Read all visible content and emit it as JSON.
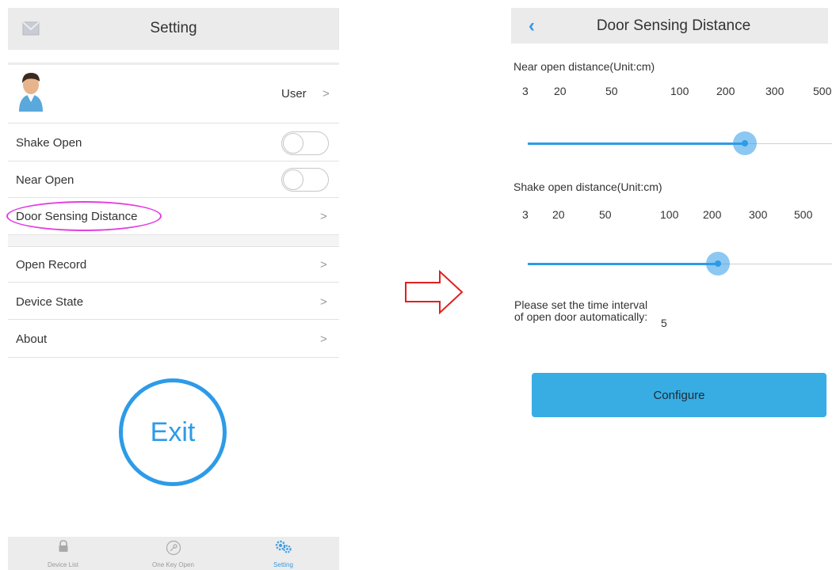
{
  "setting": {
    "title": "Setting",
    "user_label": "User",
    "rows": {
      "shake_open": "Shake Open",
      "near_open": "Near Open",
      "door_sensing": "Door Sensing Distance",
      "open_record": "Open Record",
      "device_state": "Device State",
      "about": "About"
    },
    "chevron": ">",
    "toggles": {
      "shake_open": false,
      "near_open": false
    },
    "exit_label": "Exit",
    "tabs": [
      {
        "label": "Device List",
        "icon": "lock-icon"
      },
      {
        "label": "One Key Open",
        "icon": "key-icon"
      },
      {
        "label": "Setting",
        "icon": "gears-icon"
      }
    ],
    "active_tab": "Setting",
    "highlight_color": "#e23de2"
  },
  "door_sensing": {
    "title": "Door Sensing Distance",
    "near": {
      "label": "Near open distance(Unit:cm)",
      "ticks": [
        "3",
        "20",
        "50",
        "100",
        "200",
        "300",
        "500"
      ],
      "value_cm": 250
    },
    "shake": {
      "label": "Shake open distance(Unit:cm)",
      "ticks": [
        "3",
        "20",
        "50",
        "100",
        "200",
        "300",
        "500"
      ],
      "value_cm": 250
    },
    "interval_label": "Please set the time interval of open door automatically:",
    "interval_value": "5",
    "configure_label": "Configure"
  },
  "colors": {
    "accent": "#2d9be8",
    "button": "#38ade3",
    "arrow": "#e02020"
  }
}
